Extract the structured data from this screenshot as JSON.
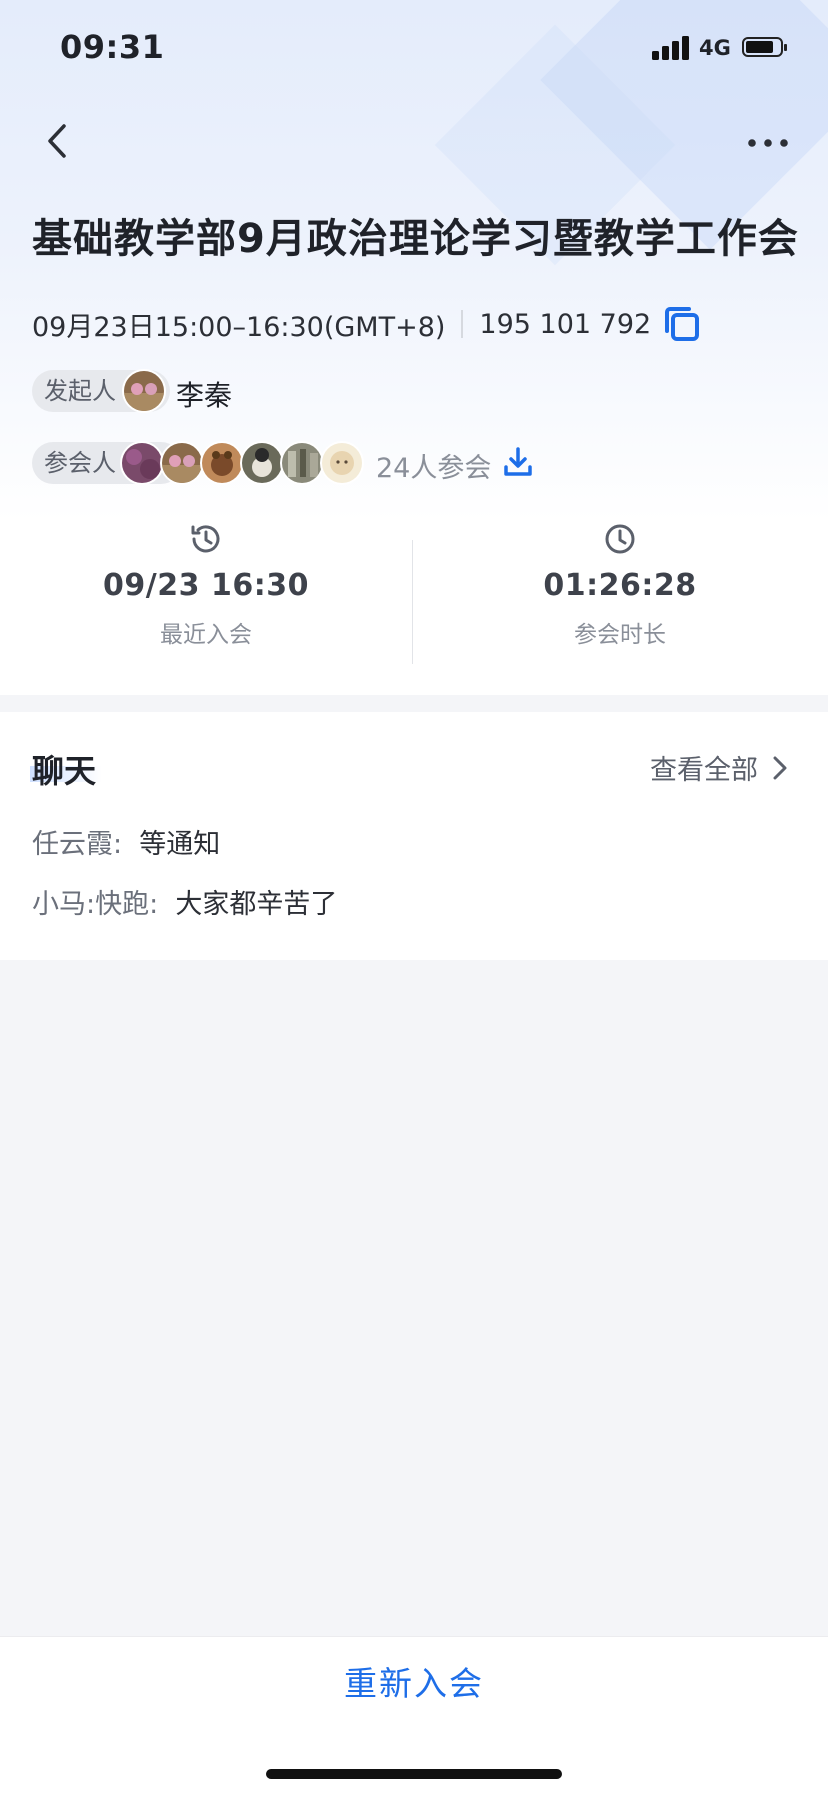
{
  "status_bar": {
    "time": "09:31",
    "network": "4G"
  },
  "meeting": {
    "title": "基础教学部9月政治理论学习暨教学工作会",
    "datetime": "09月23日15:00–16:30(GMT+8)",
    "meeting_id": "195 101 792"
  },
  "host": {
    "label": "发起人",
    "name": "李秦"
  },
  "attendees": {
    "label": "参会人",
    "count_text": "24人参会"
  },
  "stats": {
    "last_join": {
      "value": "09/23 16:30",
      "label": "最近入会"
    },
    "duration": {
      "value": "01:26:28",
      "label": "参会时长"
    }
  },
  "chat": {
    "title": "聊天",
    "view_all": "查看全部",
    "messages": [
      {
        "sender": "任云霞:",
        "text": "等通知"
      },
      {
        "sender": "小马:快跑:",
        "text": "大家都辛苦了"
      }
    ]
  },
  "footer": {
    "rejoin_label": "重新入会"
  },
  "colors": {
    "accent": "#1e6ee8",
    "background": "#f4f5f8"
  },
  "icons": [
    "back-arrow-icon",
    "more-icon",
    "copy-icon",
    "download-icon",
    "history-icon",
    "clock-icon",
    "chevron-right-icon"
  ]
}
